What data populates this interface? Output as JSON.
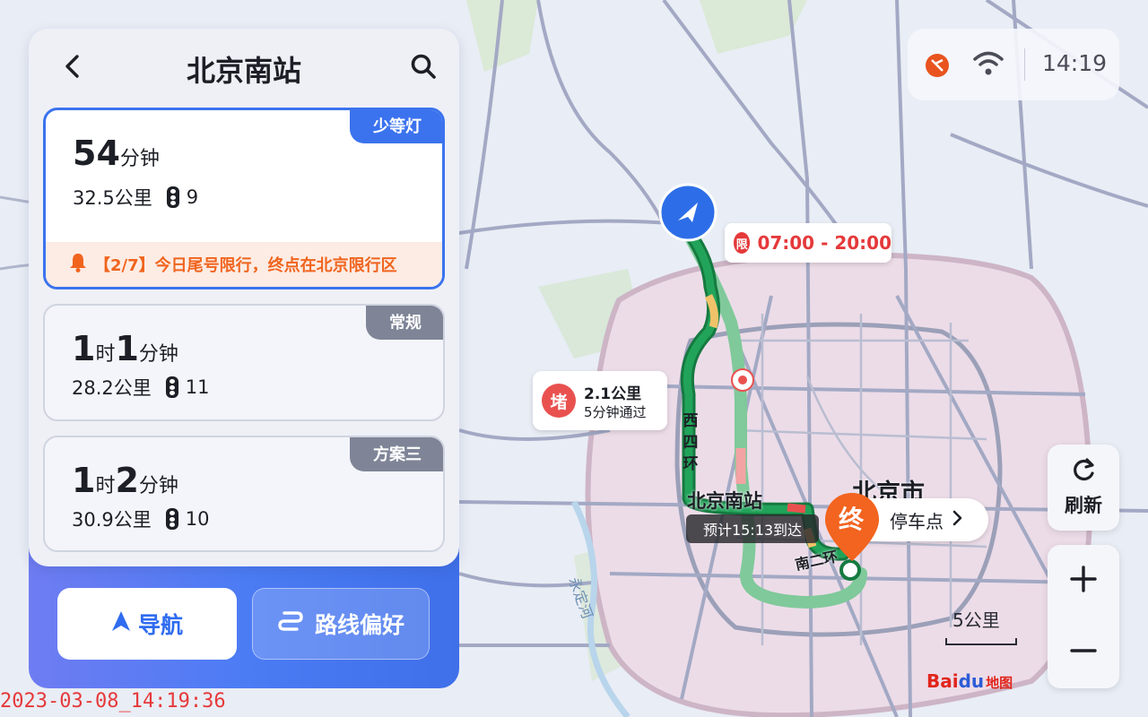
{
  "header": {
    "title": "北京南站"
  },
  "routes": [
    {
      "tag": "少等灯",
      "time_big_1": "54",
      "time_small_1": "分钟",
      "time_big_2": "",
      "time_small_2": "",
      "distance": "32.5公里",
      "lights": "9",
      "warning": "【2/7】今日尾号限行，终点在北京限行区"
    },
    {
      "tag": "常规",
      "time_big_1": "1",
      "time_small_1": "时",
      "time_big_2": "1",
      "time_small_2": "分钟",
      "distance": "28.2公里",
      "lights": "11"
    },
    {
      "tag": "方案三",
      "time_big_1": "1",
      "time_small_1": "时",
      "time_big_2": "2",
      "time_small_2": "分钟",
      "distance": "30.9公里",
      "lights": "10"
    }
  ],
  "buttons": {
    "navigate": "导航",
    "route_pref": "路线偏好",
    "refresh": "刷新"
  },
  "status": {
    "time": "14:19"
  },
  "map": {
    "limit_badge": "限",
    "limit_hours": "07:00 - 20:00",
    "jam_badge": "堵",
    "jam_distance": "2.1公里",
    "jam_time": "5分钟通过",
    "eta": "预计15:13到达",
    "dest_badge": "终",
    "parking": "停车点",
    "station_label": "北京南站",
    "city_label": "北京市",
    "road_west4": [
      "西",
      "四",
      "环"
    ],
    "road_south2": "南二环",
    "river_label": "永定河",
    "scale": "5公里",
    "logo_a": "Bai",
    "logo_b": "du",
    "logo_c": "地图"
  },
  "timestamp": "2023-03-08_14:19:36",
  "colors": {
    "accent": "#3b73ee",
    "warning": "#f0641e",
    "alert": "#e5393a",
    "route_green": "#1a8a4a",
    "route_light": "#80c99a"
  }
}
